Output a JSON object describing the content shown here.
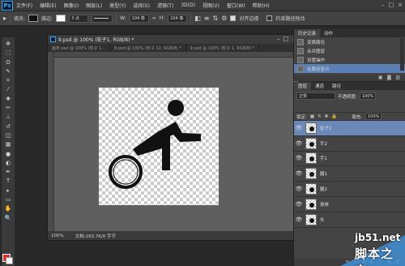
{
  "app": {
    "logo": "Ps",
    "menu": [
      "文件(F)",
      "编辑(E)",
      "图像(I)",
      "图层(L)",
      "类型(Y)",
      "选择(S)",
      "滤镜(T)",
      "3D(D)",
      "视图(V)",
      "窗口(W)",
      "帮助(H)"
    ],
    "window_controls": [
      "–",
      "□",
      "×"
    ]
  },
  "options_bar": {
    "fill_label": "填充:",
    "stroke_label": "描边:",
    "stroke_width": "3 点",
    "w_label": "W:",
    "w_value": "104 像",
    "h_label": "H:",
    "h_value": "104 像",
    "align_edges": "对齐边缘",
    "constrain_path": "约束路径拖动",
    "fill_color": "#111111",
    "stroke_color": "#ffffff"
  },
  "tools": [
    "move-icon",
    "marquee-icon",
    "lasso-icon",
    "quick-select-icon",
    "crop-icon",
    "eyedropper-icon",
    "healing-icon",
    "brush-icon",
    "clone-stamp-icon",
    "history-brush-icon",
    "eraser-icon",
    "gradient-icon",
    "blur-icon",
    "dodge-icon",
    "pen-icon",
    "type-icon",
    "path-select-icon",
    "shape-icon",
    "hand-icon",
    "zoom-icon"
  ],
  "tool_glyphs": [
    "✥",
    "⬚",
    "ʘ",
    "✎",
    "⌗",
    "⁄",
    "✚",
    "✏",
    "⊥",
    "↺",
    "◫",
    "▦",
    "●",
    "◐",
    "✒",
    "T",
    "▸",
    "▭",
    "✋",
    "🔍"
  ],
  "document": {
    "title": "9.psd @ 100% (轮子1, RGB/8) *",
    "tabs": [
      "画布.psd @ 100% (轮子 1...",
      "8.psd @ 100% (轮子 12, RGB/8) *",
      "9.psd @ 100% (轮子 1, RGB/8) *"
    ],
    "zoom": "100%",
    "doc_size": "文档:293.7K/0 字节"
  },
  "history_panel": {
    "tabs": [
      "历史记录",
      "动作"
    ],
    "items": [
      "变换路径",
      "合并图层",
      "设置操作",
      "在路径显示"
    ],
    "active_index": 3
  },
  "layers_panel": {
    "tabs": [
      "图层",
      "通道",
      "路径"
    ],
    "blend_mode": "正常",
    "opacity_label": "不透明度:",
    "opacity_value": "100%",
    "lock_label": "锁定:",
    "fill_label": "填充:",
    "fill_value": "100%",
    "layers": [
      {
        "name": "轮子1",
        "active": true
      },
      {
        "name": "手2",
        "active": false
      },
      {
        "name": "手1",
        "active": false
      },
      {
        "name": "腿1",
        "active": false
      },
      {
        "name": "腿2",
        "active": false
      },
      {
        "name": "身体",
        "active": false
      },
      {
        "name": "头",
        "active": false
      }
    ]
  },
  "watermark": {
    "url": "jb51.net",
    "text": "脚本之家"
  }
}
